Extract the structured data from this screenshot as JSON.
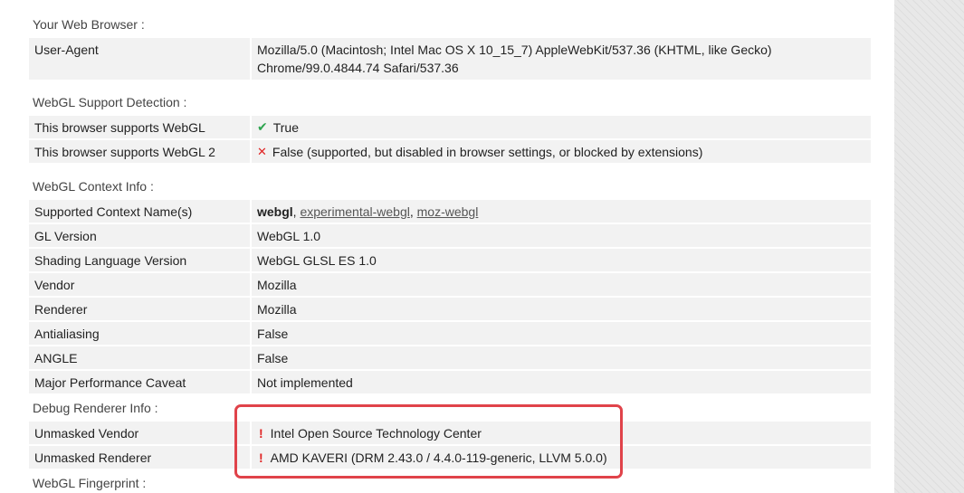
{
  "browser": {
    "section_title": "Your Web Browser :",
    "user_agent_label": "User-Agent",
    "user_agent_line1": "Mozilla/5.0 (Macintosh; Intel Mac OS X 10_15_7) AppleWebKit/537.36 (KHTML, like Gecko)",
    "user_agent_line2": "Chrome/99.0.4844.74 Safari/537.36"
  },
  "support": {
    "section_title": "WebGL Support Detection :",
    "webgl_label": "This browser supports WebGL",
    "webgl_icon": "✔",
    "webgl_value": "True",
    "webgl2_label": "This browser supports WebGL 2",
    "webgl2_icon": "✕",
    "webgl2_value": "False (supported, but disabled in browser settings, or blocked by extensions)"
  },
  "context": {
    "section_title": "WebGL Context Info :",
    "supported_names_label": "Supported Context Name(s)",
    "context_name_webgl": "webgl",
    "separator": ", ",
    "context_name_experimental": "experimental-webgl",
    "context_name_moz": "moz-webgl",
    "rows": [
      {
        "label": "GL Version",
        "value": "WebGL 1.0"
      },
      {
        "label": "Shading Language Version",
        "value": "WebGL GLSL ES 1.0"
      },
      {
        "label": "Vendor",
        "value": "Mozilla"
      },
      {
        "label": "Renderer",
        "value": "Mozilla"
      },
      {
        "label": "Antialiasing",
        "value": "False"
      },
      {
        "label": "ANGLE",
        "value": "False"
      },
      {
        "label": "Major Performance Caveat",
        "value": "Not implemented"
      }
    ]
  },
  "debug": {
    "section_title": "Debug Renderer Info :",
    "warn_icon": "!",
    "vendor_label": "Unmasked Vendor",
    "vendor_value": "Intel Open Source Technology Center",
    "renderer_label": "Unmasked Renderer",
    "renderer_value": "AMD KAVERI (DRM 2.43.0 / 4.4.0-119-generic, LLVM 5.0.0)"
  },
  "fingerprint": {
    "section_title": "WebGL Fingerprint :"
  },
  "colors": {
    "highlight_border": "#e0434a",
    "success_icon": "#2ea44f",
    "error_icon": "#e02424",
    "row_background": "#f2f2f2"
  }
}
